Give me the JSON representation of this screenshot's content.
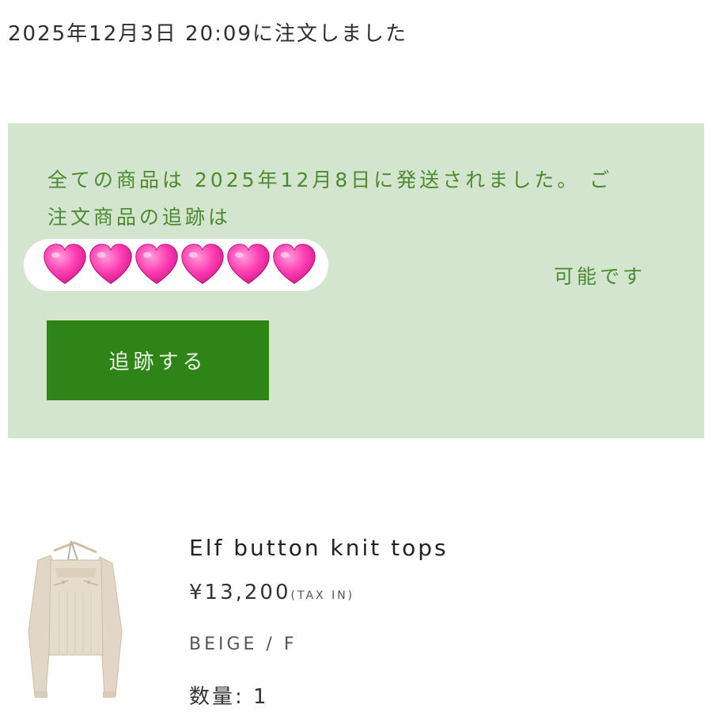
{
  "order": {
    "date_text": "2025年12月3日 20:09に注文しました"
  },
  "shipping": {
    "message": "全ての商品は 2025年12月8日に発送されました。 ご注文商品の追跡は",
    "trailing_text": "可能です",
    "hearts_icon": "pink-heart-emoji",
    "heart_color": "#ff3fb3",
    "track_button_label": "追跡する",
    "box_color": "#d3e5cf",
    "text_color": "#4d8a2f",
    "button_color": "#2e8416"
  },
  "product": {
    "name": "Elf button knit tops",
    "price": "¥13,200",
    "tax_note": "(TAX IN)",
    "variant": "BEIGE / F",
    "quantity_text": "数量: 1",
    "image_icon": "beige-knit-top"
  }
}
